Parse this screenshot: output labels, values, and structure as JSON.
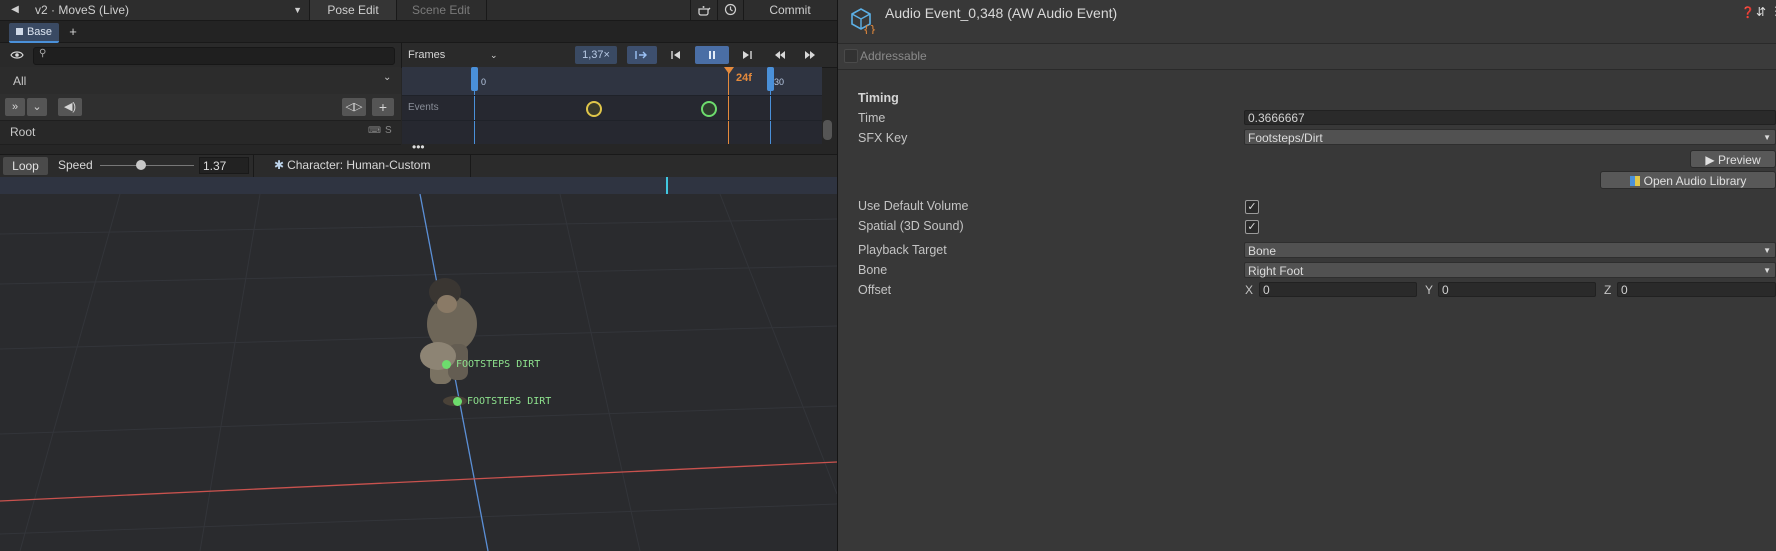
{
  "left": {
    "topbar": {
      "asset_title": "v2 · MoveS (Live)",
      "pose_edit": "Pose Edit",
      "scene_edit": "Scene Edit",
      "commit": "Commit"
    },
    "tabs": {
      "base": "Base",
      "add": "+"
    },
    "filter": {
      "label": "All"
    },
    "frames": {
      "mode": "Frames",
      "speed_multiplier": "1,37×",
      "ruler_start": "0",
      "ruler_end": "30",
      "current_frame": "24f"
    },
    "tree": {
      "events_label": "Events",
      "root_label": "Root",
      "root_s": "S"
    },
    "speed": {
      "loop": "Loop",
      "speed_label": "Speed",
      "speed_value": "1.37",
      "slider_fraction": 0.44,
      "character": "Character: Human-Custom"
    },
    "viewport": {
      "event_label_1": "FOOTSTEPS DIRT",
      "event_label_2": "FOOTSTEPS DIRT"
    }
  },
  "inspector": {
    "title": "Audio Event_0,348 (AW Audio Event)",
    "addressable": "Addressable",
    "section_timing": "Timing",
    "time_label": "Time",
    "time_value": "0.3666667",
    "sfx_label": "SFX Key",
    "sfx_value": "Footsteps/Dirt",
    "preview": "Preview",
    "open_audio_library": "Open Audio Library",
    "use_default_volume": "Use Default Volume",
    "use_default_volume_checked": true,
    "spatial": "Spatial (3D Sound)",
    "spatial_checked": true,
    "playback_target_label": "Playback Target",
    "playback_target_value": "Bone",
    "bone_label": "Bone",
    "bone_value": "Right Foot",
    "offset_label": "Offset",
    "offset_x_label": "X",
    "offset_x": "0",
    "offset_y_label": "Y",
    "offset_y": "0",
    "offset_z_label": "Z",
    "offset_z": "0"
  },
  "colors": {
    "accent_blue": "#4a90d9",
    "playhead_orange": "#e58a3c",
    "event_green": "#6ddc6d",
    "event_yellow": "#e0c64a",
    "axis_red": "#c9524e",
    "axis_blue": "#5b8fd6"
  }
}
